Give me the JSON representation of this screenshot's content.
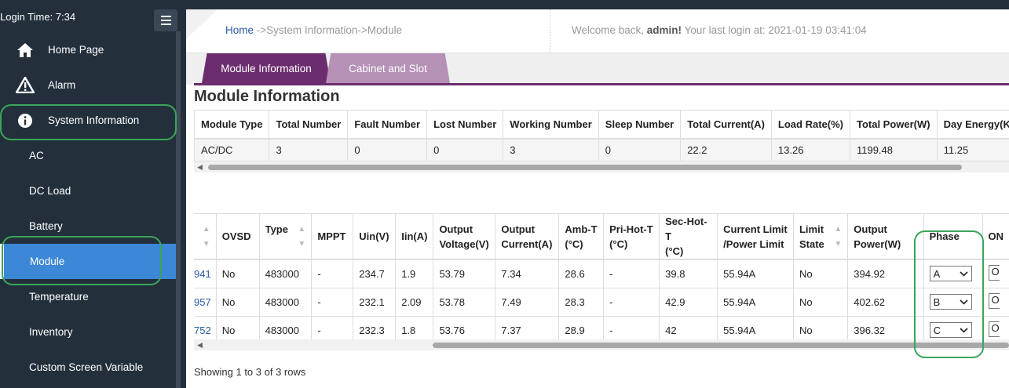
{
  "sidebar": {
    "login_time": "Login Time:  7:34",
    "menu_icon": "hamburger-icon",
    "items": [
      {
        "label": "Home Page",
        "icon": "home-icon"
      },
      {
        "label": "Alarm",
        "icon": "warning-icon"
      },
      {
        "label": "System Information",
        "icon": "info-icon"
      },
      {
        "label": "AC"
      },
      {
        "label": "DC Load"
      },
      {
        "label": "Battery"
      },
      {
        "label": "Module",
        "active": true
      },
      {
        "label": "Temperature"
      },
      {
        "label": "Inventory"
      },
      {
        "label": "Custom Screen Variable"
      }
    ]
  },
  "header": {
    "breadcrumb_home": "Home",
    "breadcrumb_rest": " ->System Information->Module",
    "welcome_prefix": "Welcome back, ",
    "user": "admin!",
    "last_login": "  Your last login at:  2021-01-19 03:41:04"
  },
  "tabs": [
    {
      "label": "Module Information",
      "active": true
    },
    {
      "label": "Cabinet and Slot"
    }
  ],
  "section_title": "Module Information",
  "summary_table": {
    "headers": [
      "Module Type",
      "Total Number",
      "Fault Number",
      "Lost Number",
      "Working Number",
      "Sleep Number",
      "Total Current(A)",
      "Load Rate(%)",
      "Total Power(W)",
      "Day Energy(KW"
    ],
    "rows": [
      [
        "AC/DC",
        "3",
        "0",
        "0",
        "3",
        "0",
        "22.2",
        "13.26",
        "1199.48",
        "11.25"
      ]
    ]
  },
  "detail_table": {
    "headers": [
      {
        "l1": "",
        "l2": ""
      },
      {
        "l1": "OVSD",
        "l2": ""
      },
      {
        "l1": "Type",
        "l2": ""
      },
      {
        "l1": "MPPT",
        "l2": ""
      },
      {
        "l1": "Uin(V)",
        "l2": ""
      },
      {
        "l1": "Iin(A)",
        "l2": ""
      },
      {
        "l1": "Output",
        "l2": "Voltage(V)"
      },
      {
        "l1": "Output",
        "l2": "Current(A)"
      },
      {
        "l1": "Amb-T",
        "l2": "(°C)"
      },
      {
        "l1": "Pri-Hot-T",
        "l2": "(°C)"
      },
      {
        "l1": "Sec-Hot-T",
        "l2": "(°C)"
      },
      {
        "l1": "Current Limit",
        "l2": "/Power Limit"
      },
      {
        "l1": "Limit",
        "l2": "State"
      },
      {
        "l1": "Output",
        "l2": "Power(W)"
      },
      {
        "l1": "Phase",
        "l2": ""
      },
      {
        "l1": "ON",
        "l2": ""
      }
    ],
    "rows": [
      {
        "sn": "941",
        "ovsd": "No",
        "type": "483000",
        "mppt": "-",
        "uin": "234.7",
        "iin": "1.9",
        "out_v": "53.79",
        "out_i": "7.34",
        "amb": "28.6",
        "pri": "-",
        "sec": "39.8",
        "limit": "55.94A",
        "limit_state": "No",
        "power": "394.92",
        "phase": "A",
        "on": "ON"
      },
      {
        "sn": "957",
        "ovsd": "No",
        "type": "483000",
        "mppt": "-",
        "uin": "232.1",
        "iin": "2.09",
        "out_v": "53.78",
        "out_i": "7.49",
        "amb": "28.3",
        "pri": "-",
        "sec": "42.9",
        "limit": "55.94A",
        "limit_state": "No",
        "power": "402.62",
        "phase": "B",
        "on": "ON"
      },
      {
        "sn": "752",
        "ovsd": "No",
        "type": "483000",
        "mppt": "-",
        "uin": "232.3",
        "iin": "1.8",
        "out_v": "53.76",
        "out_i": "7.37",
        "amb": "28.9",
        "pri": "-",
        "sec": "42",
        "limit": "55.94A",
        "limit_state": "No",
        "power": "396.32",
        "phase": "C",
        "on": "ON"
      }
    ]
  },
  "footer": "Showing 1 to 3 of 3 rows",
  "colors": {
    "sidebar": "#23303c",
    "active": "#3c87d6",
    "tab_active": "#6c2d6e",
    "tab_inactive": "#b590b7",
    "highlight": "#3aa55a"
  }
}
